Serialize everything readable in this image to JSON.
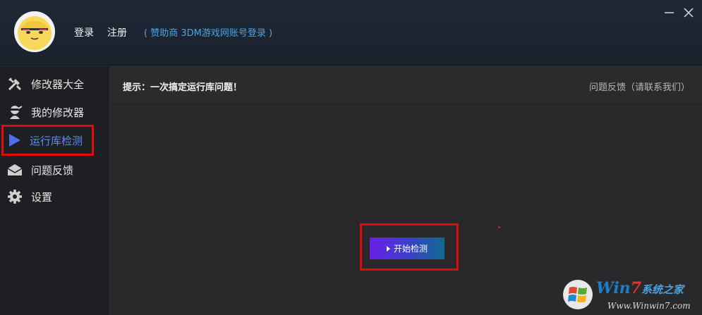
{
  "header": {
    "login_label": "登录",
    "register_label": "注册",
    "sponsor_text": "( 赞助商 3DM游戏网账号登录 )"
  },
  "window_controls": {
    "minimize_icon": "minimize-icon",
    "close_icon": "close-icon"
  },
  "sidebar": {
    "items": [
      {
        "label": "修改器大全",
        "icon": "tools-icon"
      },
      {
        "label": "我的修改器",
        "icon": "ninja-icon"
      },
      {
        "label": "运行库检测",
        "icon": "play-icon",
        "active": true
      },
      {
        "label": "问题反馈",
        "icon": "envelope-icon"
      },
      {
        "label": "设置",
        "icon": "gear-icon"
      }
    ]
  },
  "main": {
    "tip": "提示：一次搞定运行库问题！",
    "feedback": "问题反馈（请联系我们）",
    "start_button_label": "开始检测"
  },
  "watermark": {
    "title_prefix": "Win",
    "title_seven": "7",
    "title_suffix": "系统之家",
    "url": "Www.Winwin7.com"
  },
  "colors": {
    "accent_blue": "#5a8cff",
    "highlight_red": "#e10b0b",
    "button_gradient_start": "#6a1ee6",
    "button_gradient_end": "#0e6a8e"
  }
}
